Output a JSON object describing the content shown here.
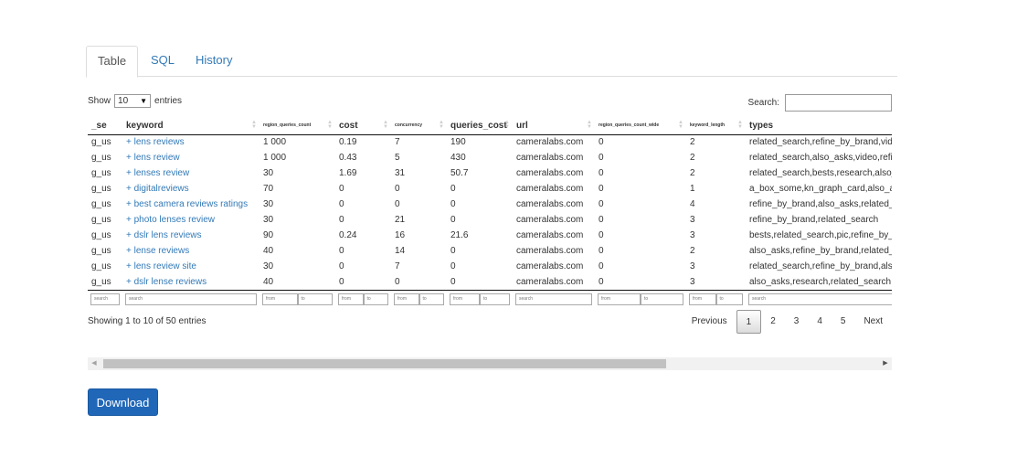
{
  "tabs": [
    {
      "label": "Table",
      "active": true
    },
    {
      "label": "SQL",
      "active": false
    },
    {
      "label": "History",
      "active": false
    }
  ],
  "length_control": {
    "prefix": "Show",
    "value": "10",
    "suffix": "entries"
  },
  "search": {
    "label": "Search:",
    "value": ""
  },
  "table": {
    "columns": [
      "_se",
      "keyword",
      "region_queries_count",
      "cost",
      "concurrency",
      "queries_cost",
      "url",
      "region_queries_count_wide",
      "keyword_length",
      "types"
    ],
    "rows": [
      [
        "g_us",
        "+ lens reviews",
        "1 000",
        "0.19",
        "7",
        "190",
        "cameralabs.com",
        "0",
        "2",
        "related_search,refine_by_brand,video"
      ],
      [
        "g_us",
        "+ lens review",
        "1 000",
        "0.43",
        "5",
        "430",
        "cameralabs.com",
        "0",
        "2",
        "related_search,also_asks,video,refine"
      ],
      [
        "g_us",
        "+ lenses review",
        "30",
        "1.69",
        "31",
        "50.7",
        "cameralabs.com",
        "0",
        "2",
        "related_search,bests,research,also_"
      ],
      [
        "g_us",
        "+ digitalreviews",
        "70",
        "0",
        "0",
        "0",
        "cameralabs.com",
        "0",
        "1",
        "a_box_some,kn_graph_card,also_a"
      ],
      [
        "g_us",
        "+ best camera reviews ratings",
        "30",
        "0",
        "0",
        "0",
        "cameralabs.com",
        "0",
        "4",
        "refine_by_brand,also_asks,related_"
      ],
      [
        "g_us",
        "+ photo lenses review",
        "30",
        "0",
        "21",
        "0",
        "cameralabs.com",
        "0",
        "3",
        "refine_by_brand,related_search"
      ],
      [
        "g_us",
        "+ dslr lens reviews",
        "90",
        "0.24",
        "16",
        "21.6",
        "cameralabs.com",
        "0",
        "3",
        "bests,related_search,pic,refine_by_"
      ],
      [
        "g_us",
        "+ lense reviews",
        "40",
        "0",
        "14",
        "0",
        "cameralabs.com",
        "0",
        "2",
        "also_asks,refine_by_brand,related_"
      ],
      [
        "g_us",
        "+ lens review site",
        "30",
        "0",
        "7",
        "0",
        "cameralabs.com",
        "0",
        "3",
        "related_search,refine_by_brand,also"
      ],
      [
        "g_us",
        "+ dslr lense reviews",
        "40",
        "0",
        "0",
        "0",
        "cameralabs.com",
        "0",
        "3",
        "also_asks,research,related_search,"
      ]
    ],
    "filters": {
      "search": "search",
      "from": "from",
      "to": "to"
    }
  },
  "info": "Showing 1 to 10 of 50 entries",
  "pagination": {
    "previous": "Previous",
    "pages": [
      "1",
      "2",
      "3",
      "4",
      "5"
    ],
    "current": "1",
    "next": "Next"
  },
  "download_label": "Download"
}
